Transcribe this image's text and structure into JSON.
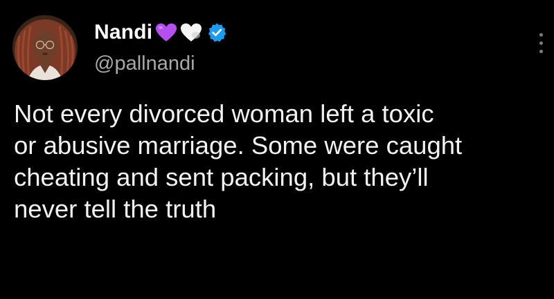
{
  "author": {
    "display_name": "Nandi",
    "handle": "@pallnandi",
    "emojis": [
      "purple-heart",
      "white-heart"
    ],
    "verified": true,
    "verified_color": "#1d9bf0"
  },
  "tweet": {
    "text": "Not every divorced woman left a toxic\nor abusive marriage. Some were caught\ncheating and sent packing, but they’ll\nnever tell the truth"
  },
  "colors": {
    "background": "#000000",
    "text": "#ffffff",
    "secondary_text": "#a9a9a9",
    "purple_heart": "#b64ff0",
    "white_heart": "#f4f4f4"
  },
  "icons": {
    "more": "more-vertical-icon",
    "verified": "verified-badge-icon"
  }
}
